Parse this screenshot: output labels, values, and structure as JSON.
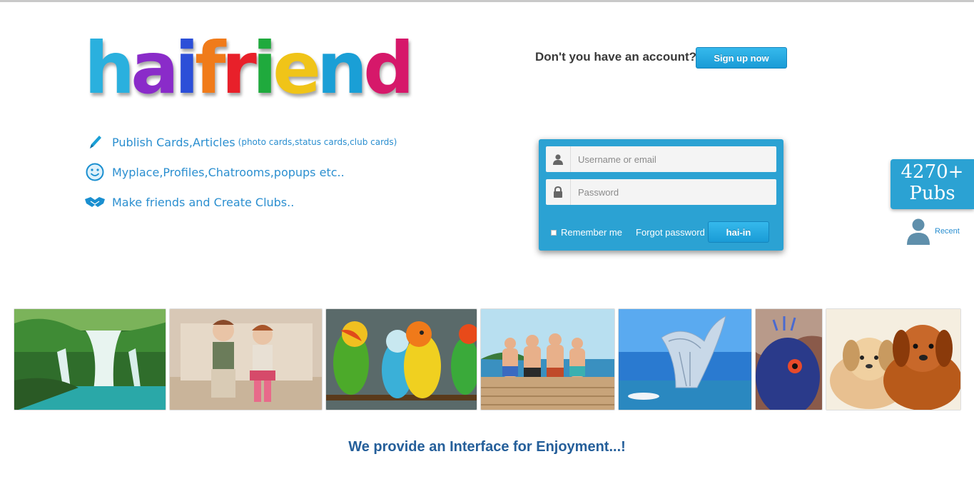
{
  "logo": {
    "text": "haifriend",
    "letters": [
      {
        "ch": "h",
        "color": "#2ab0de"
      },
      {
        "ch": "a",
        "color": "#8a2bc9"
      },
      {
        "ch": "i",
        "color": "#2c4fd8"
      },
      {
        "ch": "f",
        "color": "#f07b1a"
      },
      {
        "ch": "r",
        "color": "#e8202a"
      },
      {
        "ch": "i",
        "color": "#1faa3d"
      },
      {
        "ch": "e",
        "color": "#f0c418"
      },
      {
        "ch": "n",
        "color": "#1a9fd6"
      },
      {
        "ch": "d",
        "color": "#d6186a"
      }
    ]
  },
  "features": [
    {
      "icon": "pen-icon",
      "text": "Publish Cards,Articles",
      "sub": "(photo cards,status cards,club cards)"
    },
    {
      "icon": "smiley-icon",
      "text": "Myplace,Profiles,Chatrooms,popups etc..",
      "sub": ""
    },
    {
      "icon": "handshake-icon",
      "text": "Make friends and Create Clubs..",
      "sub": ""
    }
  ],
  "signup": {
    "prompt": "Don't you have an account?",
    "button": "Sign up now"
  },
  "login": {
    "username_placeholder": "Username or email",
    "password_placeholder": "Password",
    "remember_label": "Remember me",
    "forgot_label": "Forgot password",
    "submit_label": "hai-in"
  },
  "pubs": {
    "count": "4270+",
    "label": "Pubs",
    "recent_label": "Recent"
  },
  "gallery": [
    {
      "name": "waterfall-photo"
    },
    {
      "name": "kids-photo"
    },
    {
      "name": "parrots-photo"
    },
    {
      "name": "children-pier-photo"
    },
    {
      "name": "building-photo"
    },
    {
      "name": "bird-photo"
    },
    {
      "name": "puppies-photo"
    }
  ],
  "tagline": "We provide an Interface for Enjoyment...!",
  "colors": {
    "accent": "#2ba2d3",
    "link": "#2b8fd0",
    "tagline": "#255f9a"
  }
}
